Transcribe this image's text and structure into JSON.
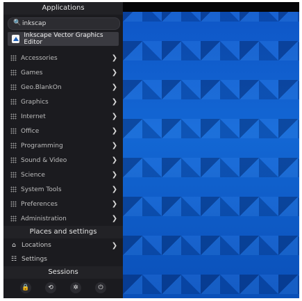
{
  "menu": {
    "applications_header": "Applications",
    "search": {
      "value": "inkscap",
      "icon": "search-icon"
    },
    "result": {
      "label": "Inkscape Vector Graphics Editor",
      "icon": "inkscape-icon"
    },
    "categories": [
      {
        "label": "Accessories"
      },
      {
        "label": "Games"
      },
      {
        "label": "Geo.BlankOn"
      },
      {
        "label": "Graphics"
      },
      {
        "label": "Internet"
      },
      {
        "label": "Office"
      },
      {
        "label": "Programming"
      },
      {
        "label": "Sound & Video"
      },
      {
        "label": "Science"
      },
      {
        "label": "System Tools"
      },
      {
        "label": "Preferences"
      },
      {
        "label": "Administration"
      }
    ],
    "places_header": "Places and settings",
    "places": [
      {
        "label": "Locations",
        "icon": "home-icon"
      },
      {
        "label": "Settings",
        "icon": "settings-icon"
      }
    ],
    "sessions_header": "Sessions",
    "session_buttons": [
      {
        "icon": "lock-icon",
        "glyph": "🔒"
      },
      {
        "icon": "logout-icon",
        "glyph": "⟲"
      },
      {
        "icon": "suspend-icon",
        "glyph": "✲"
      },
      {
        "icon": "power-icon",
        "glyph": "⏻"
      }
    ]
  }
}
